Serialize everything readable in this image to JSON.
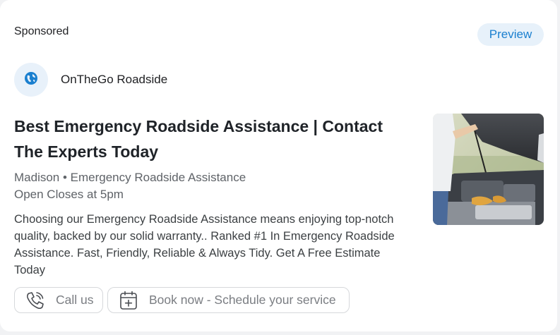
{
  "ad": {
    "sponsored_label": "Sponsored",
    "preview_label": "Preview",
    "advertiser_name": "OnTheGo Roadside",
    "advertiser_icon": "globe-icon",
    "headline": "Best Emergency Roadside Assistance | Contact The Experts Today",
    "location_line": "Madison • Emergency Roadside Assistance",
    "hours_line": "Open Closes at 5pm",
    "description": "Choosing our Emergency Roadside Assistance means enjoying top-notch quality, backed by our solid warranty.. Ranked #1 In Emergency Roadside Assistance. Fast, Friendly, Reliable & Always Tidy. Get A Free Estimate Today",
    "image": "car-engine-photo"
  },
  "actions": {
    "call_label": "Call us",
    "call_icon": "phone-icon",
    "book_label": "Book now - Schedule your service",
    "book_icon": "calendar-add-icon"
  },
  "colors": {
    "accent": "#1a7fcf",
    "preview_bg": "#e7f1fa",
    "headline": "#1f2328",
    "muted": "#5f6368"
  }
}
